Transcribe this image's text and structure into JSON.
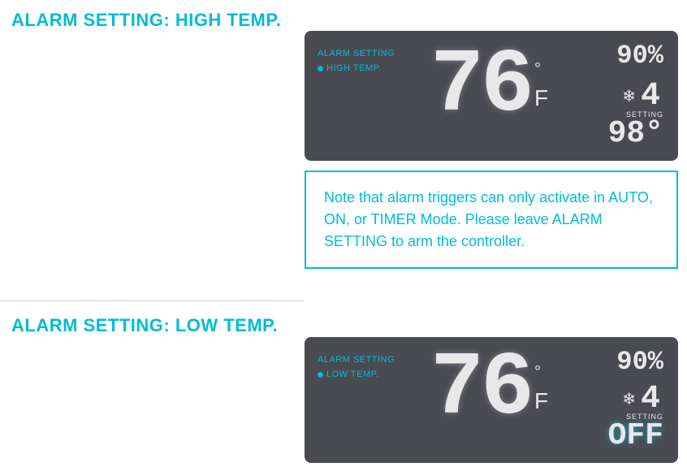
{
  "top_section": {
    "heading": "ALARM SETTING: HIGH TEMP.",
    "panel": {
      "main_value": "76",
      "unit_degree": "°",
      "unit_f": "F",
      "corner_percent": "90%",
      "label_alarm": "ALARM SETTING",
      "label_sub": "HIGH TEMP.",
      "fan_number": "4",
      "setting_label": "SETTING",
      "setting_value": "98°"
    }
  },
  "note": {
    "text": "Note that alarm triggers can only activate in AUTO, ON, or TIMER Mode. Please leave ALARM SETTING to arm the controller."
  },
  "bottom_section": {
    "heading": "ALARM SETTING: LOW TEMP.",
    "panel": {
      "main_value": "76",
      "unit_degree": "°",
      "unit_f": "F",
      "corner_percent": "90%",
      "label_alarm": "ALARM SETTING",
      "label_sub": "LOW TEMP.",
      "fan_number": "4",
      "setting_label": "SETTING",
      "setting_value": "OFF"
    }
  },
  "colors": {
    "accent": "#00bcd4",
    "panel_bg": "#4a4a52",
    "lcd_text": "#e8e8e8",
    "off_color": "#00e5ff"
  }
}
